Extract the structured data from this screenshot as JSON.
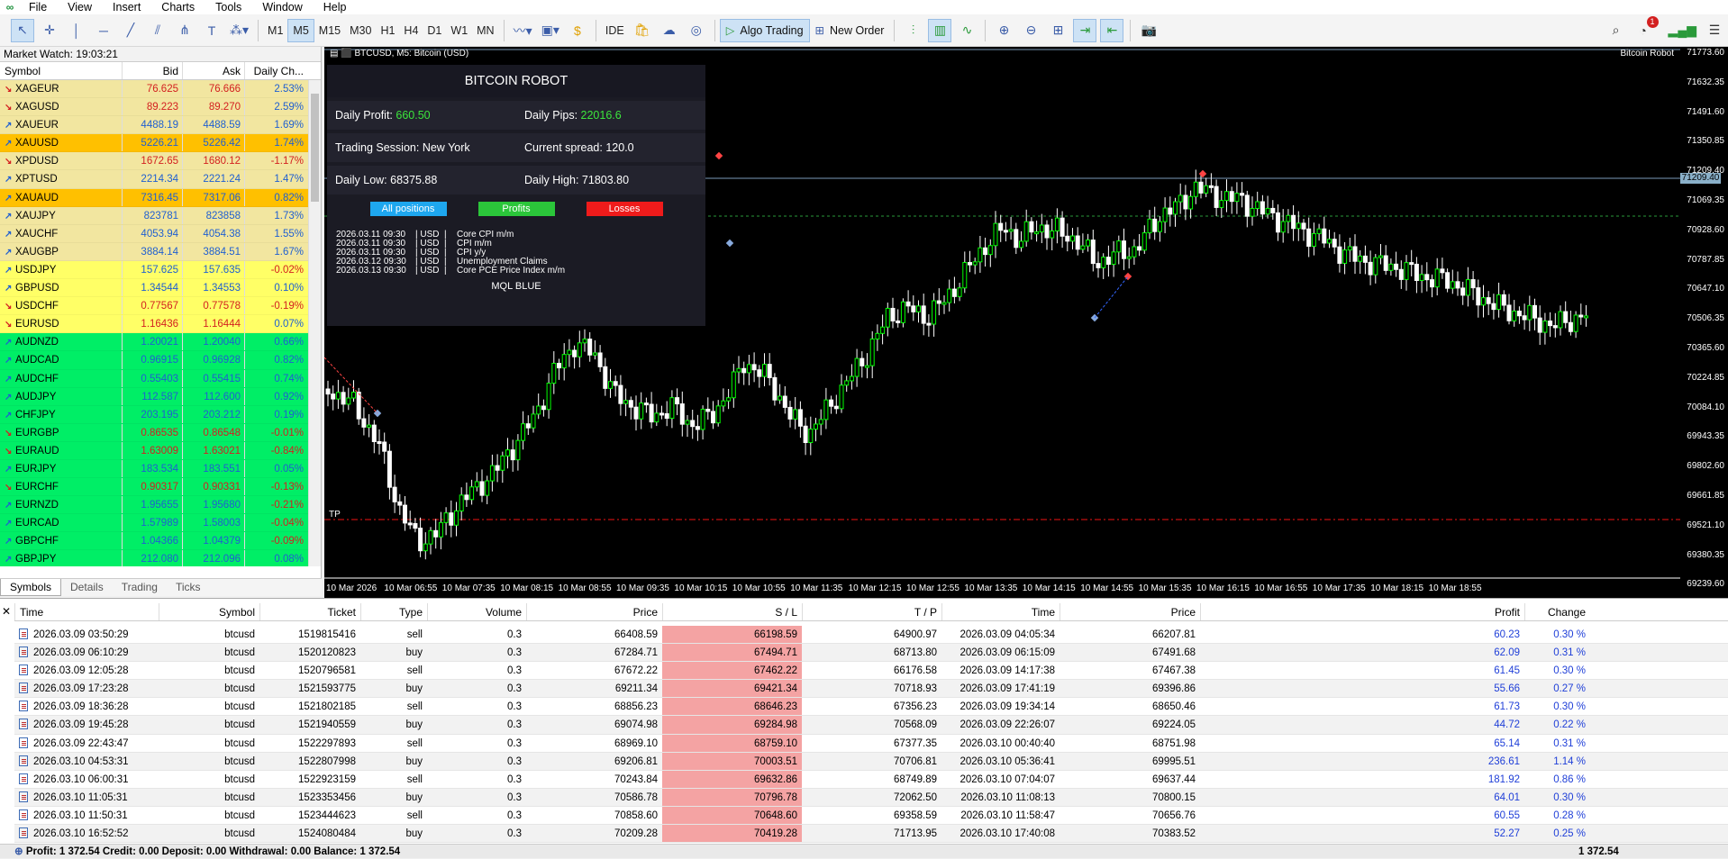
{
  "menu": {
    "items": [
      "File",
      "View",
      "Insert",
      "Charts",
      "Tools",
      "Window",
      "Help"
    ]
  },
  "toolbar": {
    "timeframes": [
      "M1",
      "M5",
      "M15",
      "M30",
      "H1",
      "H4",
      "D1",
      "W1",
      "MN"
    ],
    "active_tf": "M5",
    "ide_label": "IDE",
    "algo_label": "Algo Trading",
    "neworder_label": "New Order",
    "notif_count": "1"
  },
  "market_watch": {
    "title": "Market Watch: 19:03:21",
    "headers": [
      "Symbol",
      "Bid",
      "Ask",
      "Daily Ch..."
    ],
    "rows": [
      {
        "sym": "XAGEUR",
        "bid": "76.625",
        "ask": "76.666",
        "chg": "2.53%",
        "dir": "dn",
        "bg": "#f2e6a0"
      },
      {
        "sym": "XAGUSD",
        "bid": "89.223",
        "ask": "89.270",
        "chg": "2.59%",
        "dir": "dn",
        "bg": "#f2e6a0"
      },
      {
        "sym": "XAUEUR",
        "bid": "4488.19",
        "ask": "4488.59",
        "chg": "1.69%",
        "dir": "up",
        "bg": "#f2e6a0"
      },
      {
        "sym": "XAUUSD",
        "bid": "5226.21",
        "ask": "5226.42",
        "chg": "1.74%",
        "dir": "up",
        "bg": "#ffc000"
      },
      {
        "sym": "XPDUSD",
        "bid": "1672.65",
        "ask": "1680.12",
        "chg": "-1.17%",
        "dir": "dn",
        "bg": "#f2e6a0"
      },
      {
        "sym": "XPTUSD",
        "bid": "2214.34",
        "ask": "2221.24",
        "chg": "1.47%",
        "dir": "up",
        "bg": "#f2e6a0"
      },
      {
        "sym": "XAUAUD",
        "bid": "7316.45",
        "ask": "7317.06",
        "chg": "0.82%",
        "dir": "up",
        "bg": "#ffc000"
      },
      {
        "sym": "XAUJPY",
        "bid": "823781",
        "ask": "823858",
        "chg": "1.73%",
        "dir": "up",
        "bg": "#f2e6a0"
      },
      {
        "sym": "XAUCHF",
        "bid": "4053.94",
        "ask": "4054.38",
        "chg": "1.55%",
        "dir": "up",
        "bg": "#f2e6a0"
      },
      {
        "sym": "XAUGBP",
        "bid": "3884.14",
        "ask": "3884.51",
        "chg": "1.67%",
        "dir": "up",
        "bg": "#f2e6a0"
      },
      {
        "sym": "USDJPY",
        "bid": "157.625",
        "ask": "157.635",
        "chg": "-0.02%",
        "dir": "up",
        "bg": "#ffff66"
      },
      {
        "sym": "GBPUSD",
        "bid": "1.34544",
        "ask": "1.34553",
        "chg": "0.10%",
        "dir": "up",
        "bg": "#ffff66"
      },
      {
        "sym": "USDCHF",
        "bid": "0.77567",
        "ask": "0.77578",
        "chg": "-0.19%",
        "dir": "dn",
        "bg": "#ffff66"
      },
      {
        "sym": "EURUSD",
        "bid": "1.16436",
        "ask": "1.16444",
        "chg": "0.07%",
        "dir": "dn",
        "bg": "#ffff66"
      },
      {
        "sym": "AUDNZD",
        "bid": "1.20021",
        "ask": "1.20040",
        "chg": "0.66%",
        "dir": "up",
        "bg": "#00ee66"
      },
      {
        "sym": "AUDCAD",
        "bid": "0.96915",
        "ask": "0.96928",
        "chg": "0.82%",
        "dir": "up",
        "bg": "#00ee66"
      },
      {
        "sym": "AUDCHF",
        "bid": "0.55403",
        "ask": "0.55415",
        "chg": "0.74%",
        "dir": "up",
        "bg": "#00ee66"
      },
      {
        "sym": "AUDJPY",
        "bid": "112.587",
        "ask": "112.600",
        "chg": "0.92%",
        "dir": "up",
        "bg": "#00ee66"
      },
      {
        "sym": "CHFJPY",
        "bid": "203.195",
        "ask": "203.212",
        "chg": "0.19%",
        "dir": "up",
        "bg": "#00ee66"
      },
      {
        "sym": "EURGBP",
        "bid": "0.86535",
        "ask": "0.86548",
        "chg": "-0.01%",
        "dir": "dn",
        "bg": "#00ee66"
      },
      {
        "sym": "EURAUD",
        "bid": "1.63009",
        "ask": "1.63021",
        "chg": "-0.84%",
        "dir": "dn",
        "bg": "#00ee66"
      },
      {
        "sym": "EURJPY",
        "bid": "183.534",
        "ask": "183.551",
        "chg": "0.05%",
        "dir": "up",
        "bg": "#00ee66"
      },
      {
        "sym": "EURCHF",
        "bid": "0.90317",
        "ask": "0.90331",
        "chg": "-0.13%",
        "dir": "dn",
        "bg": "#00ee66"
      },
      {
        "sym": "EURNZD",
        "bid": "1.95655",
        "ask": "1.95680",
        "chg": "-0.21%",
        "dir": "up",
        "bg": "#00ee66"
      },
      {
        "sym": "EURCAD",
        "bid": "1.57989",
        "ask": "1.58003",
        "chg": "-0.04%",
        "dir": "up",
        "bg": "#00ee66"
      },
      {
        "sym": "GBPCHF",
        "bid": "1.04366",
        "ask": "1.04379",
        "chg": "-0.09%",
        "dir": "up",
        "bg": "#00ee66"
      },
      {
        "sym": "GBPJPY",
        "bid": "212.080",
        "ask": "212.096",
        "chg": "0.08%",
        "dir": "up",
        "bg": "#00ee66"
      }
    ],
    "tabs": [
      "Symbols",
      "Details",
      "Trading",
      "Ticks"
    ]
  },
  "chart": {
    "title": "BTCUSD, M5: Bitcoin (USD)",
    "indicator": "Bitcoin Robot",
    "tp_label": "TP",
    "current_price": "71209.40",
    "y_ticks": [
      "71773.60",
      "71632.35",
      "71491.60",
      "71350.85",
      "71209.40",
      "71069.35",
      "70928.60",
      "70787.85",
      "70647.10",
      "70506.35",
      "70365.60",
      "70224.85",
      "70084.10",
      "69943.35",
      "69802.60",
      "69661.85",
      "69521.10",
      "69380.35",
      "69239.60"
    ],
    "x_ticks": [
      "10 Mar 2026",
      "10 Mar 06:55",
      "10 Mar 07:35",
      "10 Mar 08:15",
      "10 Mar 08:55",
      "10 Mar 09:35",
      "10 Mar 10:15",
      "10 Mar 10:55",
      "10 Mar 11:35",
      "10 Mar 12:15",
      "10 Mar 12:55",
      "10 Mar 13:35",
      "10 Mar 14:15",
      "10 Mar 14:55",
      "10 Mar 15:35",
      "10 Mar 16:15",
      "10 Mar 16:55",
      "10 Mar 17:35",
      "10 Mar 18:15",
      "10 Mar 18:55"
    ]
  },
  "robot_panel": {
    "title": "BITCOIN ROBOT",
    "daily_profit_label": "Daily Profit:",
    "daily_profit": "660.50",
    "daily_pips_label": "Daily Pips:",
    "daily_pips": "22016.6",
    "session_label": "Trading Session:",
    "session": "New York",
    "spread_label": "Current spread:",
    "spread": "120.0",
    "low_label": "Daily Low:",
    "low": "68375.88",
    "high_label": "Daily High:",
    "high": "71803.80",
    "btn_all": "All positions",
    "btn_profits": "Profits",
    "btn_losses": "Losses",
    "news": [
      {
        "date": "2026.03.11 09:30",
        "cur": "USD",
        "name": "Core CPI m/m"
      },
      {
        "date": "2026.03.11 09:30",
        "cur": "USD",
        "name": "CPI m/m"
      },
      {
        "date": "2026.03.11 09:30",
        "cur": "USD",
        "name": "CPI y/y"
      },
      {
        "date": "2026.03.12 09:30",
        "cur": "USD",
        "name": "Unemployment Claims"
      },
      {
        "date": "2026.03.13 09:30",
        "cur": "USD",
        "name": "Core PCE Price Index m/m"
      }
    ],
    "brand": "MQL BLUE"
  },
  "history": {
    "headers": [
      "Time",
      "Symbol",
      "Ticket",
      "Type",
      "Volume",
      "Price",
      "S / L",
      "T / P",
      "Time",
      "Price",
      "Profit",
      "Change"
    ],
    "rows": [
      [
        "2026.03.09 03:50:29",
        "btcusd",
        "1519815416",
        "sell",
        "0.3",
        "66408.59",
        "66198.59",
        "64900.97",
        "2026.03.09 04:05:34",
        "66207.81",
        "60.23",
        "0.30 %"
      ],
      [
        "2026.03.09 06:10:29",
        "btcusd",
        "1520120823",
        "buy",
        "0.3",
        "67284.71",
        "67494.71",
        "68713.80",
        "2026.03.09 06:15:09",
        "67491.68",
        "62.09",
        "0.31 %"
      ],
      [
        "2026.03.09 12:05:28",
        "btcusd",
        "1520796581",
        "sell",
        "0.3",
        "67672.22",
        "67462.22",
        "66176.58",
        "2026.03.09 14:17:38",
        "67467.38",
        "61.45",
        "0.30 %"
      ],
      [
        "2026.03.09 17:23:28",
        "btcusd",
        "1521593775",
        "buy",
        "0.3",
        "69211.34",
        "69421.34",
        "70718.93",
        "2026.03.09 17:41:19",
        "69396.86",
        "55.66",
        "0.27 %"
      ],
      [
        "2026.03.09 18:36:28",
        "btcusd",
        "1521802185",
        "sell",
        "0.3",
        "68856.23",
        "68646.23",
        "67356.23",
        "2026.03.09 19:34:14",
        "68650.46",
        "61.73",
        "0.30 %"
      ],
      [
        "2026.03.09 19:45:28",
        "btcusd",
        "1521940559",
        "buy",
        "0.3",
        "69074.98",
        "69284.98",
        "70568.09",
        "2026.03.09 22:26:07",
        "69224.05",
        "44.72",
        "0.22 %"
      ],
      [
        "2026.03.09 22:43:47",
        "btcusd",
        "1522297893",
        "sell",
        "0.3",
        "68969.10",
        "68759.10",
        "67377.35",
        "2026.03.10 00:40:40",
        "68751.98",
        "65.14",
        "0.31 %"
      ],
      [
        "2026.03.10 04:53:31",
        "btcusd",
        "1522807998",
        "buy",
        "0.3",
        "69206.81",
        "70003.51",
        "70706.81",
        "2026.03.10 05:36:41",
        "69995.51",
        "236.61",
        "1.14 %"
      ],
      [
        "2026.03.10 06:00:31",
        "btcusd",
        "1522923159",
        "sell",
        "0.3",
        "70243.84",
        "69632.86",
        "68749.89",
        "2026.03.10 07:04:07",
        "69637.44",
        "181.92",
        "0.86 %"
      ],
      [
        "2026.03.10 11:05:31",
        "btcusd",
        "1523353456",
        "buy",
        "0.3",
        "70586.78",
        "70796.78",
        "72062.50",
        "2026.03.10 11:08:13",
        "70800.15",
        "64.01",
        "0.30 %"
      ],
      [
        "2026.03.10 11:50:31",
        "btcusd",
        "1523444623",
        "sell",
        "0.3",
        "70858.60",
        "70648.60",
        "69358.59",
        "2026.03.10 11:58:47",
        "70656.76",
        "60.55",
        "0.28 %"
      ],
      [
        "2026.03.10 16:52:52",
        "btcusd",
        "1524080484",
        "buy",
        "0.3",
        "70209.28",
        "70419.28",
        "71713.95",
        "2026.03.10 17:40:08",
        "70383.52",
        "52.27",
        "0.25 %"
      ]
    ],
    "footer": "Profit: 1 372.54  Credit: 0.00  Deposit: 0.00  Withdrawal: 0.00  Balance: 1 372.54",
    "footer_total": "1 372.54"
  }
}
